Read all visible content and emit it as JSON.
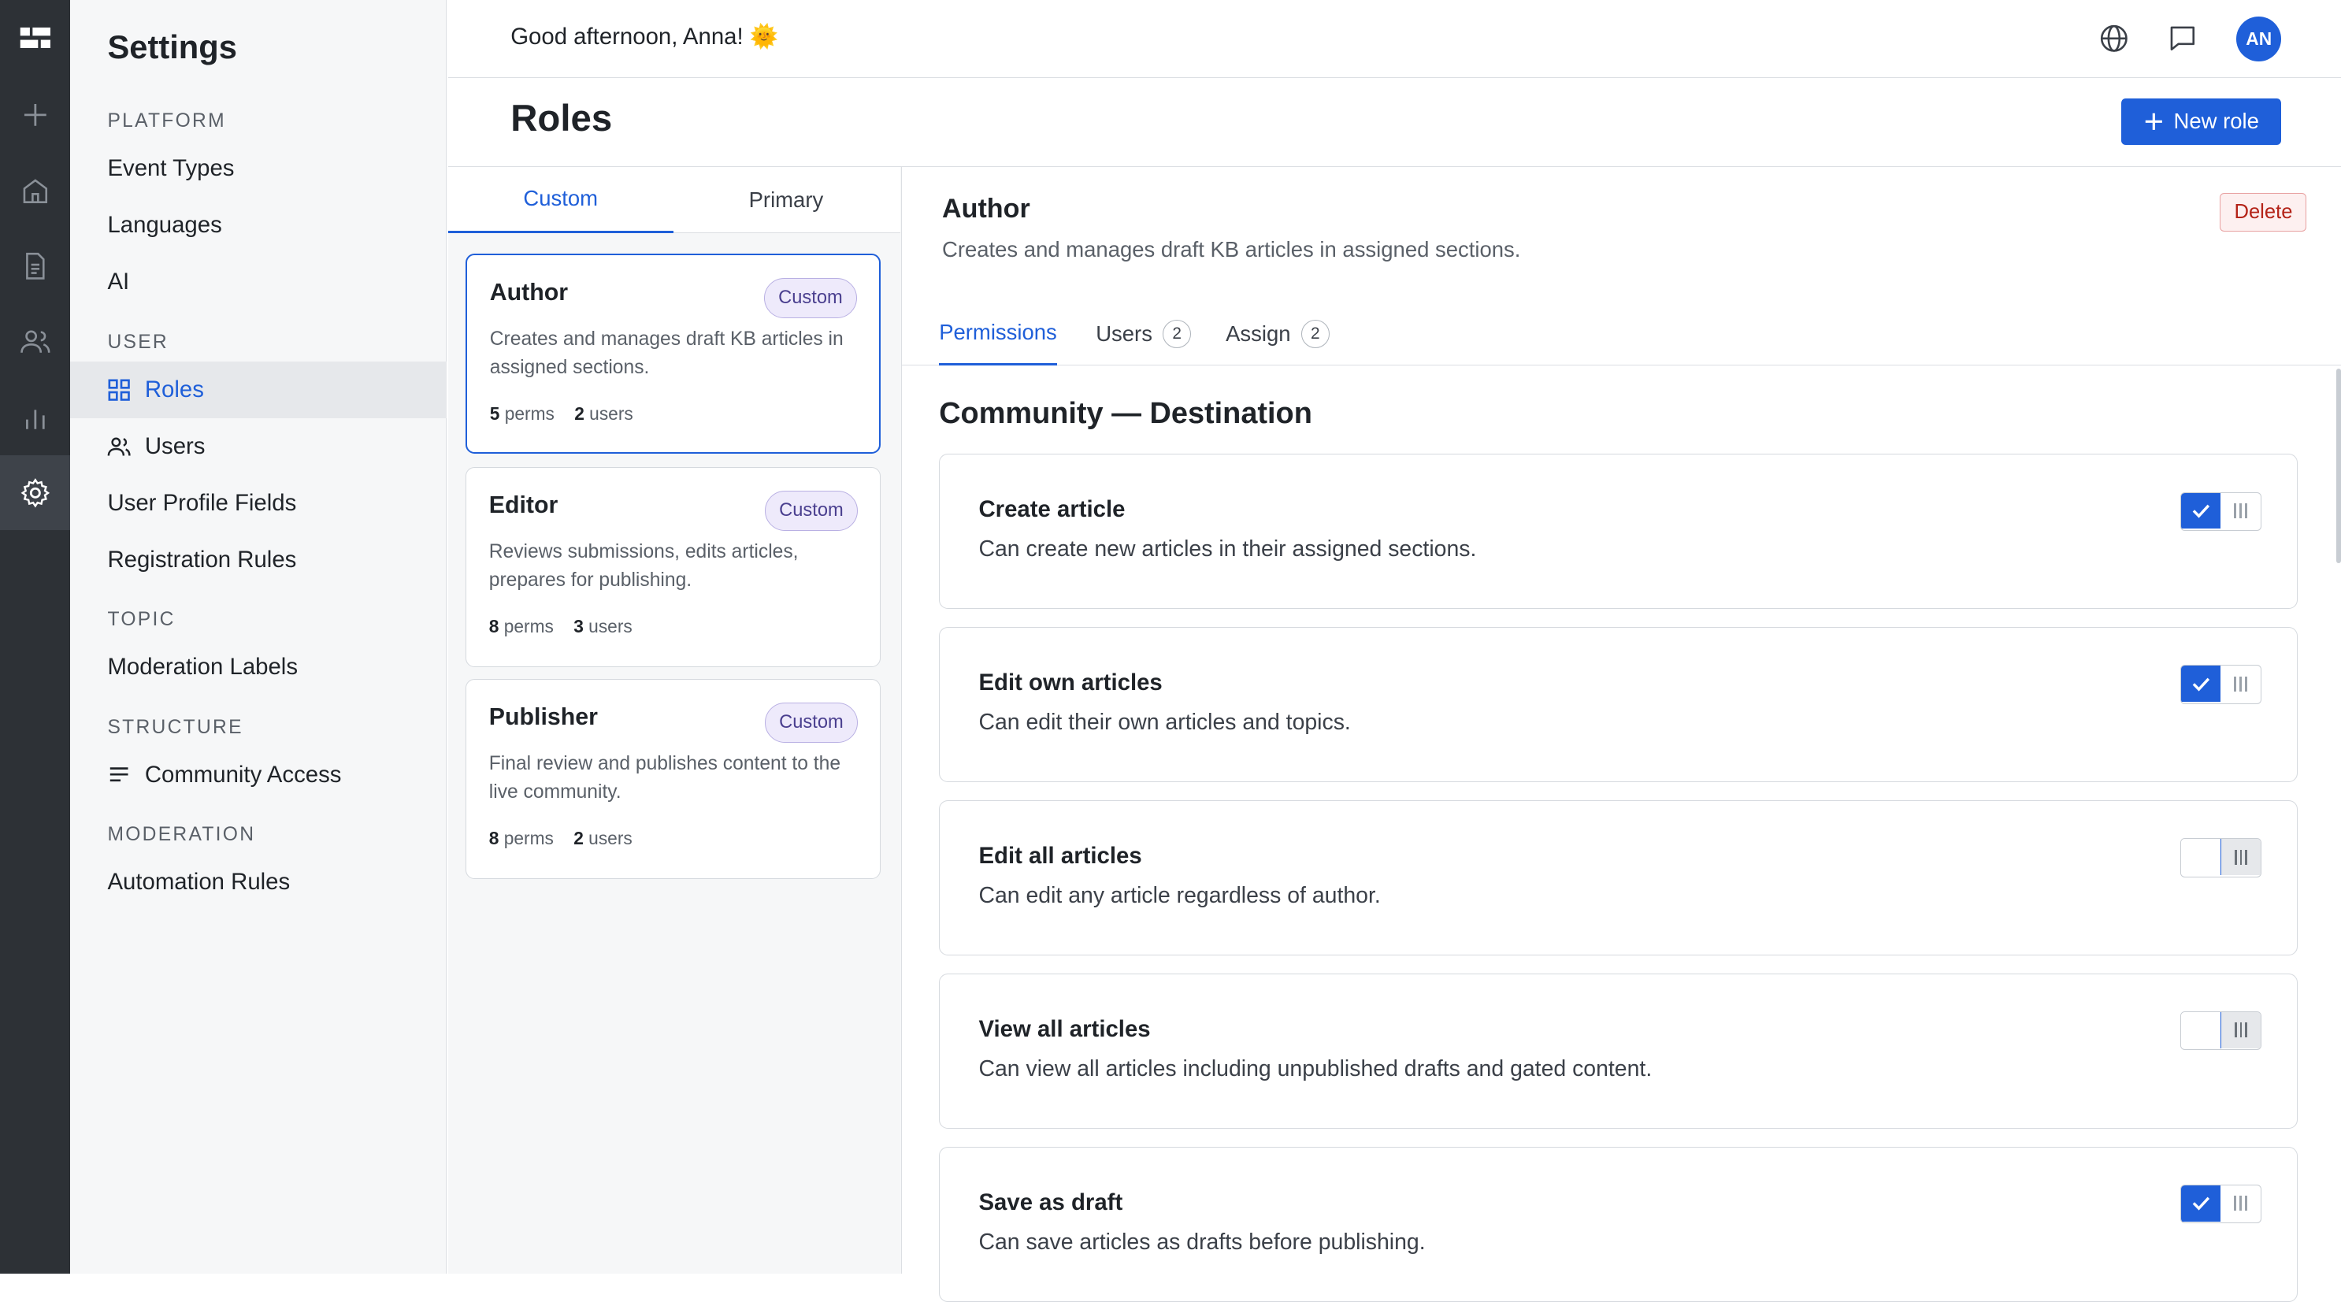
{
  "header": {
    "greeting": "Good afternoon, Anna! 🌞",
    "avatar_initials": "AN"
  },
  "sidebar": {
    "title": "Settings",
    "sections": [
      {
        "label": "PLATFORM",
        "items": [
          "Event Types",
          "Languages",
          "AI"
        ]
      },
      {
        "label": "USER",
        "items": [
          "Roles",
          "Users",
          "User Profile Fields",
          "Registration Rules"
        ]
      },
      {
        "label": "TOPIC",
        "items": [
          "Moderation Labels"
        ]
      },
      {
        "label": "STRUCTURE",
        "items": [
          "Community Access"
        ]
      },
      {
        "label": "MODERATION",
        "items": [
          "Automation Rules"
        ]
      }
    ],
    "active_item": "Roles"
  },
  "page": {
    "title": "Roles",
    "new_role_label": "New role"
  },
  "role_tabs": [
    {
      "label": "Custom",
      "active": true
    },
    {
      "label": "Primary",
      "active": false
    }
  ],
  "roles": [
    {
      "name": "Author",
      "badge": "Custom",
      "description": "Creates and manages draft KB articles in assigned sections.",
      "perms": "5",
      "perms_label": "perms",
      "users": "2",
      "users_label": "users",
      "selected": true
    },
    {
      "name": "Editor",
      "badge": "Custom",
      "description": "Reviews submissions, edits articles, prepares for publishing.",
      "perms": "8",
      "perms_label": "perms",
      "users": "3",
      "users_label": "users",
      "selected": false
    },
    {
      "name": "Publisher",
      "badge": "Custom",
      "description": "Final review and publishes content to the live community.",
      "perms": "8",
      "perms_label": "perms",
      "users": "2",
      "users_label": "users",
      "selected": false
    }
  ],
  "detail": {
    "title": "Author",
    "description": "Creates and manages draft KB articles in assigned sections.",
    "delete_label": "Delete",
    "tabs": [
      {
        "label": "Permissions",
        "count": null,
        "active": true
      },
      {
        "label": "Users",
        "count": "2",
        "active": false
      },
      {
        "label": "Assign",
        "count": "2",
        "active": false
      }
    ],
    "section_title": "Community — Destination",
    "permissions": [
      {
        "title": "Create article",
        "description": "Can create new articles in their assigned sections.",
        "enabled": true
      },
      {
        "title": "Edit own articles",
        "description": "Can edit their own articles and topics.",
        "enabled": true
      },
      {
        "title": "Edit all articles",
        "description": "Can edit any article regardless of author.",
        "enabled": false
      },
      {
        "title": "View all articles",
        "description": "Can view all articles including unpublished drafts and gated content.",
        "enabled": false
      },
      {
        "title": "Save as draft",
        "description": "Can save articles as drafts before publishing.",
        "enabled": true
      }
    ]
  },
  "colors": {
    "accent": "#1f5fd9",
    "rail": "#2d3136",
    "danger": "#b42318"
  },
  "icons": {
    "rail": [
      "grid-logo-icon",
      "plus-icon",
      "home-icon",
      "document-icon",
      "users-icon",
      "bar-chart-icon",
      "gear-icon"
    ],
    "topbar": [
      "globe-icon",
      "chat-icon"
    ]
  }
}
